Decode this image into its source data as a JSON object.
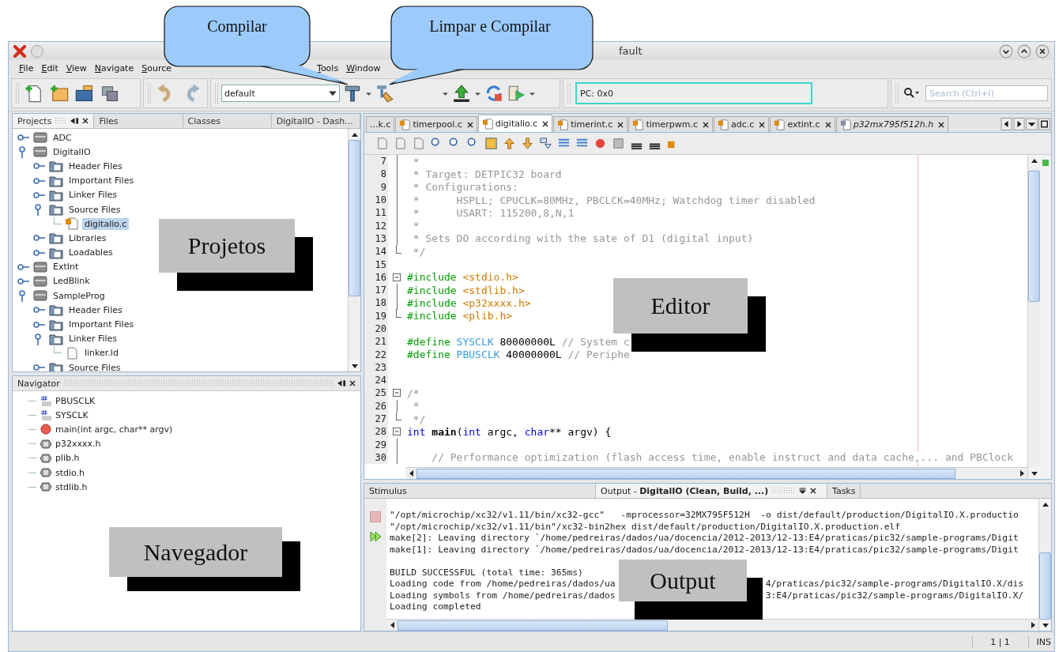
{
  "window": {
    "title": "fault"
  },
  "menu_items": [
    "File",
    "Edit",
    "View",
    "Navigate",
    "Source"
  ],
  "menu_items_after_callout": [
    "Tools",
    "Window"
  ],
  "toolbar": {
    "configuration": "default",
    "pc_field": "PC: 0x0",
    "search_placeholder": "Search (Ctrl+I)"
  },
  "projects_panel": {
    "tabs": [
      {
        "label": "Projects",
        "selected": true
      },
      {
        "label": "Files",
        "selected": false
      },
      {
        "label": "Classes",
        "selected": false
      },
      {
        "label": "DigitalIO - Dash...",
        "selected": false
      }
    ],
    "tree": [
      {
        "label": "ADC",
        "kind": "project",
        "expanded": false,
        "selected": false
      },
      {
        "label": "DigitalIO",
        "kind": "project",
        "expanded": true,
        "selected": false,
        "children": [
          {
            "label": "Header Files",
            "kind": "folder",
            "expanded": false,
            "selected": false
          },
          {
            "label": "Important Files",
            "kind": "folder",
            "expanded": false,
            "selected": false
          },
          {
            "label": "Linker Files",
            "kind": "folder",
            "expanded": false,
            "selected": false
          },
          {
            "label": "Source Files",
            "kind": "folder",
            "expanded": true,
            "selected": false,
            "children": [
              {
                "label": "digitalio.c",
                "kind": "c-file",
                "selected": true
              }
            ]
          },
          {
            "label": "Libraries",
            "kind": "folder",
            "expanded": false,
            "selected": false
          },
          {
            "label": "Loadables",
            "kind": "folder",
            "expanded": false,
            "selected": false
          }
        ]
      },
      {
        "label": "ExtInt",
        "kind": "project",
        "expanded": false,
        "selected": false
      },
      {
        "label": "LedBlink",
        "kind": "project",
        "expanded": false,
        "selected": false
      },
      {
        "label": "SampleProg",
        "kind": "project",
        "expanded": true,
        "selected": false,
        "children": [
          {
            "label": "Header Files",
            "kind": "folder",
            "expanded": false,
            "selected": false
          },
          {
            "label": "Important Files",
            "kind": "folder",
            "expanded": false,
            "selected": false
          },
          {
            "label": "Linker Files",
            "kind": "folder",
            "expanded": true,
            "selected": false,
            "children": [
              {
                "label": "linker.ld",
                "kind": "file",
                "selected": false
              }
            ]
          },
          {
            "label": "Source Files",
            "kind": "folder",
            "expanded": false,
            "selected": false
          }
        ]
      }
    ]
  },
  "navigator": {
    "title": "Navigator",
    "items": [
      {
        "label": "PBUSCLK",
        "kind": "define"
      },
      {
        "label": "SYSCLK",
        "kind": "define"
      },
      {
        "label": "main(int argc, char** argv)",
        "kind": "function"
      },
      {
        "label": "p32xxxx.h",
        "kind": "include"
      },
      {
        "label": "plib.h",
        "kind": "include"
      },
      {
        "label": "stdio.h",
        "kind": "include"
      },
      {
        "label": "stdlib.h",
        "kind": "include"
      }
    ]
  },
  "editor": {
    "tabs": [
      {
        "label": "...k.c",
        "kind": "truncated",
        "selected": false
      },
      {
        "label": "timerpool.c",
        "kind": "source",
        "selected": false
      },
      {
        "label": "digitalio.c",
        "kind": "source",
        "selected": true
      },
      {
        "label": "timerint.c",
        "kind": "source",
        "selected": false
      },
      {
        "label": "timerpwm.c",
        "kind": "source",
        "selected": false
      },
      {
        "label": "adc.c",
        "kind": "source",
        "selected": false
      },
      {
        "label": "extint.c",
        "kind": "source",
        "selected": false
      },
      {
        "label": "p32mx795f512h.h",
        "kind": "header",
        "selected": false
      }
    ],
    "lines": [
      {
        "n": "7",
        "kind": "inside",
        "tokens": [
          {
            "text": " *",
            "kind": "comment"
          }
        ]
      },
      {
        "n": "8",
        "kind": "inside",
        "tokens": [
          {
            "text": " * Target: DETPIC32 board",
            "kind": "comment"
          }
        ]
      },
      {
        "n": "9",
        "kind": "inside",
        "tokens": [
          {
            "text": " * Configurations:",
            "kind": "comment"
          }
        ]
      },
      {
        "n": "10",
        "kind": "inside",
        "tokens": [
          {
            "text": " *      HSPLL; CPUCLK=80MHz, PBCLCK=40MHz; Watchdog timer disabled",
            "kind": "comment"
          }
        ]
      },
      {
        "n": "11",
        "kind": "inside",
        "tokens": [
          {
            "text": " *      USART: 115200,8,N,1",
            "kind": "comment"
          }
        ]
      },
      {
        "n": "12",
        "kind": "inside",
        "tokens": [
          {
            "text": " *",
            "kind": "comment"
          }
        ]
      },
      {
        "n": "13",
        "kind": "inside",
        "tokens": [
          {
            "text": " * Sets DO according with the sate of D1 (digital input)",
            "kind": "comment"
          }
        ]
      },
      {
        "n": "14",
        "kind": "end",
        "tokens": [
          {
            "text": " */",
            "kind": "comment"
          }
        ]
      },
      {
        "n": "15",
        "kind": "plain"
      },
      {
        "n": "16",
        "kind": "start",
        "tokens": [
          {
            "text": "#include",
            "kind": "directive"
          },
          {
            "text": " <stdio.h>",
            "kind": "header"
          }
        ]
      },
      {
        "n": "17",
        "kind": "inside",
        "tokens": [
          {
            "text": "#include",
            "kind": "directive"
          },
          {
            "text": " <stdlib.h>",
            "kind": "header"
          }
        ]
      },
      {
        "n": "18",
        "kind": "inside",
        "tokens": [
          {
            "text": "#include",
            "kind": "directive"
          },
          {
            "text": " <p32xxxx.h>",
            "kind": "header"
          }
        ]
      },
      {
        "n": "19",
        "kind": "end",
        "tokens": [
          {
            "text": "#include",
            "kind": "directive"
          },
          {
            "text": " <plib.h>",
            "kind": "header"
          }
        ]
      },
      {
        "n": "20",
        "kind": "plain"
      },
      {
        "n": "21",
        "kind": "plain",
        "tokens": [
          {
            "text": "#define",
            "kind": "directive"
          },
          {
            "text": " SYSCLK",
            "kind": "macro"
          },
          {
            "text": " 80000000L",
            "kind": "plain"
          },
          {
            "text": " // System c",
            "kind": "comment"
          }
        ]
      },
      {
        "n": "22",
        "kind": "plain",
        "tokens": [
          {
            "text": "#define",
            "kind": "directive"
          },
          {
            "text": " PBUSCLK",
            "kind": "macro"
          },
          {
            "text": " 40000000L",
            "kind": "plain"
          },
          {
            "text": " // Periphe",
            "kind": "comment"
          }
        ]
      },
      {
        "n": "23",
        "kind": "plain"
      },
      {
        "n": "24",
        "kind": "plain"
      },
      {
        "n": "25",
        "kind": "start",
        "tokens": [
          {
            "text": "/*",
            "kind": "comment"
          }
        ]
      },
      {
        "n": "26",
        "kind": "inside",
        "tokens": [
          {
            "text": " *",
            "kind": "comment"
          }
        ]
      },
      {
        "n": "27",
        "kind": "end",
        "tokens": [
          {
            "text": " */",
            "kind": "comment"
          }
        ]
      },
      {
        "n": "28",
        "kind": "start",
        "tokens": [
          {
            "text": "int",
            "kind": "keyword"
          },
          {
            "text": " main",
            "kind": "function"
          },
          {
            "text": "(",
            "kind": "plain"
          },
          {
            "text": "int",
            "kind": "keyword"
          },
          {
            "text": " argc, ",
            "kind": "plain"
          },
          {
            "text": "char",
            "kind": "keyword"
          },
          {
            "text": "** argv) {",
            "kind": "plain"
          }
        ]
      },
      {
        "n": "29",
        "kind": "inside"
      },
      {
        "n": "30",
        "kind": "inside",
        "tokens": [
          {
            "text": "    // Performance optimization (flash access time, enable instruct and data cache,... and PBClock",
            "kind": "comment"
          }
        ]
      }
    ]
  },
  "output": {
    "tabs": [
      {
        "label": "Stimulus",
        "selected": false
      },
      {
        "label": "Output - **DigitalIO (Clean, Build, ...)**",
        "selected": true
      },
      {
        "label": "Tasks",
        "selected": false
      }
    ],
    "lines": [
      {
        "parts": [
          "\"/opt/microchip/xc32/v1.11/bin/xc32-gcc\"   -mprocessor=32MX795F512H  -o dist/default/production/DigitalIO.X.productio"
        ]
      },
      {
        "parts": [
          "\"/opt/microchip/xc32/v1.11/bin\"/xc32-bin2hex dist/default/production/DigitalIO.X.production.elf"
        ]
      },
      {
        "parts": [
          "make[2]: Leaving directory `/home/pedreiras/dados/ua/docencia/2012-2013/12-13:E4/praticas/pic32/sample-programs/Digit"
        ]
      },
      {
        "parts": [
          "make[1]: Leaving directory `/home/pedreiras/dados/ua/docencia/2012-2013/12-13:E4/praticas/pic32/sample-programs/Digit"
        ]
      },
      {
        "parts": [
          "BUILD SUCCESSFUL (total time: 365ms)"
        ],
        "blank_before": true
      },
      {
        "parts": [
          "Loading code from /home/pedreiras/dados/ua",
          "4/praticas/pic32/sample-programs/DigitalIO.X/dis"
        ]
      },
      {
        "parts": [
          "Loading symbols from /home/pedreiras/dados",
          "3:E4/praticas/pic32/sample-programs/DigitalIO.X/"
        ]
      },
      {
        "parts": [
          "Loading completed"
        ]
      }
    ]
  },
  "status_bar": {
    "position": "1 | 1",
    "mode": "INS"
  },
  "callouts": [
    {
      "text": "Compilar"
    },
    {
      "text": "Limpar e Compilar"
    }
  ],
  "section_labels": [
    {
      "text": "Projetos"
    },
    {
      "text": "Editor"
    },
    {
      "text": "Navegador"
    },
    {
      "text": "Output"
    }
  ]
}
